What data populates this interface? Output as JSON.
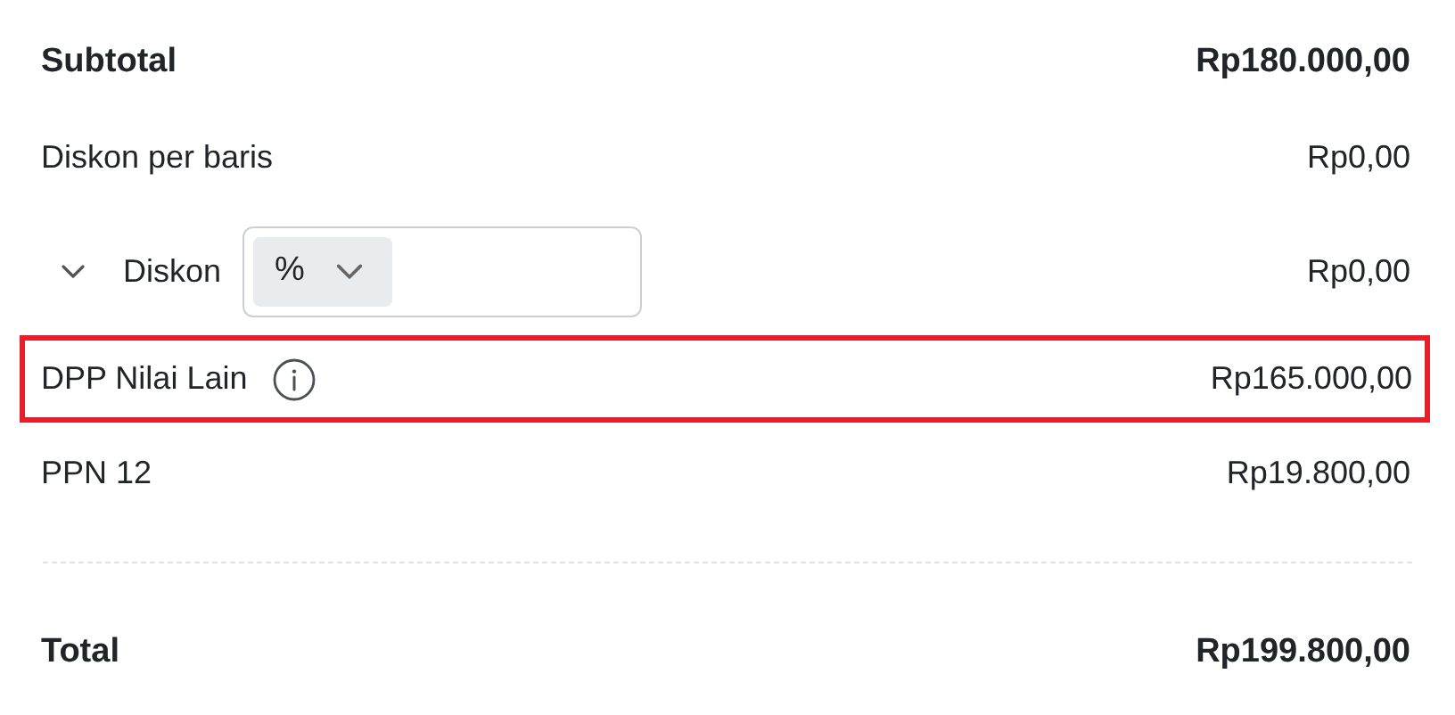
{
  "rows": [
    {
      "kind": "total",
      "label": "Subtotal",
      "amount": "Rp180.000,00",
      "highlighted": false
    },
    {
      "kind": "plain",
      "label": "Diskon per baris",
      "amount": "Rp0,00",
      "highlighted": false
    },
    {
      "kind": "discount",
      "label": "Diskon",
      "expanded": false,
      "unit": "%",
      "amount": "Rp0,00",
      "highlighted": false
    },
    {
      "kind": "info",
      "label": "DPP Nilai Lain",
      "amount": "Rp165.000,00",
      "highlighted": true
    },
    {
      "kind": "plain",
      "label": "PPN 12",
      "amount": "Rp19.800,00",
      "highlighted": false
    },
    {
      "kind": "divider"
    },
    {
      "kind": "total",
      "label": "Total",
      "amount": "Rp199.800,00",
      "highlighted": false
    }
  ]
}
